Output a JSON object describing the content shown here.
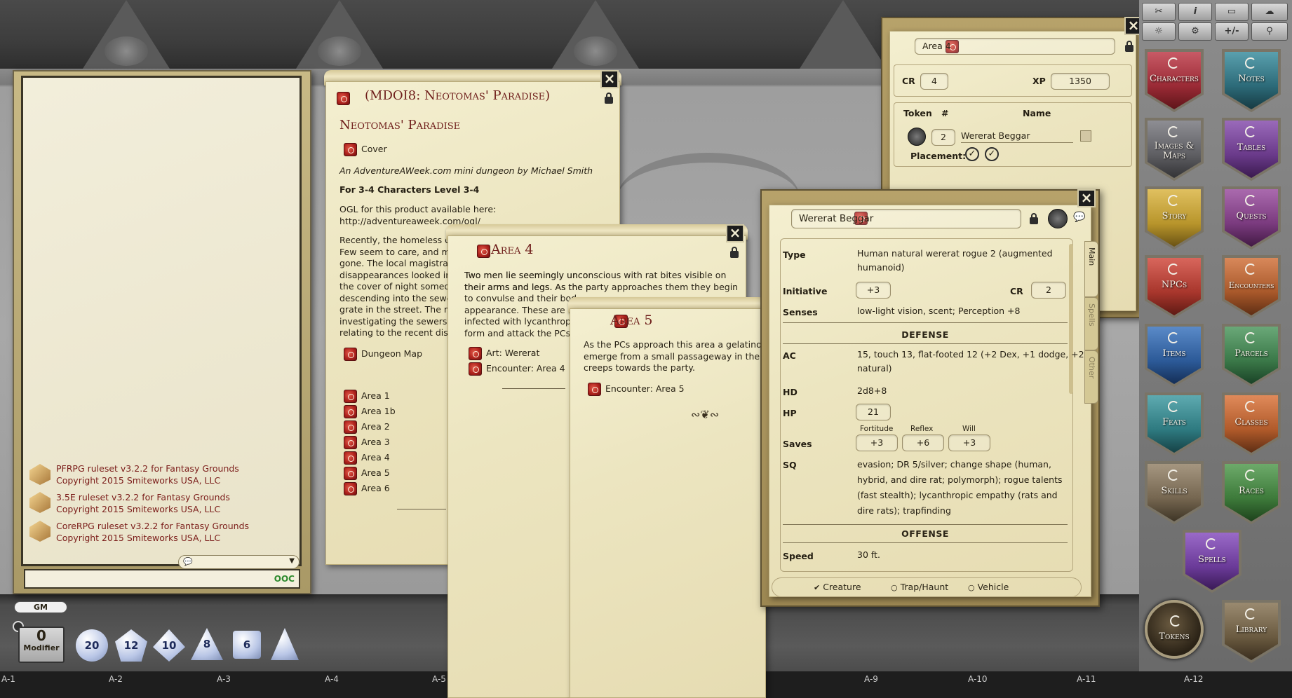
{
  "chat": {
    "messages": [
      {
        "line1": "PFRPG ruleset v3.2.2 for Fantasy Grounds",
        "line2": "Copyright 2015 Smiteworks USA, LLC"
      },
      {
        "line1": "3.5E ruleset v3.2.2 for Fantasy Grounds",
        "line2": "Copyright 2015 Smiteworks USA, LLC"
      },
      {
        "line1": "CoreRPG ruleset v3.2.2 for Fantasy Grounds",
        "line2": "Copyright 2015 Smiteworks USA, LLC"
      }
    ],
    "mode_label": "OOC",
    "gm_label": "GM"
  },
  "modifier": {
    "value": "0",
    "label": "Modifier"
  },
  "dice": [
    "20",
    "12",
    "10",
    "8",
    "6",
    "4"
  ],
  "grid_labels": [
    "A-1",
    "A-2",
    "A-3",
    "A-4",
    "A-5",
    "A-9",
    "A-10",
    "A-11",
    "A-12"
  ],
  "story": {
    "window_title": "(MDOI8: Neotomas' Paradise)",
    "heading": "Neotomas' Paradise",
    "cover_link": "Cover",
    "byline": "An AdventureAWeek.com mini dungeon by Michael Smith",
    "level": "For 3-4 Characters Level 3-4",
    "ogl1": "OGL for this product available here:",
    "ogl2": "http://adventureaweek.com/ogl/",
    "para": [
      "Recently, the homeless of",
      "Few seem to care, and ma",
      "gone. The local magistrat",
      "disappearances looked int",
      "the cover of night someo",
      "descending into the sewe",
      "grate in the street. The m",
      "investigating the sewers",
      "relating to the recent dis"
    ],
    "map_link": "Dungeon Map",
    "areas": [
      "Area 1",
      "Area 1b",
      "Area 2",
      "Area 3",
      "Area 4",
      "Area 5",
      "Area 6"
    ]
  },
  "area4": {
    "title": "Area 4",
    "text": [
      "Two men lie seemingly unconscious with rat bites visible on",
      "their arms and legs. As the party approaches them they begin",
      "to convulse and their bod",
      "appearance. These are tw",
      "infected with lycanthrop",
      "form and attack the PCs."
    ],
    "links": [
      "Art: Wererat",
      "Encounter: Area 4"
    ]
  },
  "area5": {
    "title": "Area 5",
    "text": [
      "As the PCs approach this area a gelatinous",
      "emerge from a small passageway in the no",
      "creeps towards the party."
    ],
    "link": "Encounter: Area 5"
  },
  "encounter": {
    "name": "Area 4",
    "cr_label": "CR",
    "cr": "4",
    "xp_label": "XP",
    "xp": "1350",
    "token_header": "Token",
    "count_header": "#",
    "name_header": "Name",
    "count": "2",
    "creature": "Wererat Beggar",
    "placement_label": "Placement:"
  },
  "npc": {
    "name": "Wererat Beggar",
    "tabs": [
      "Main",
      "Spells",
      "Other"
    ],
    "type_label": "Type",
    "type": [
      "Human natural wererat rogue 2 (augmented",
      "humanoid)"
    ],
    "init_label": "Initiative",
    "init": "+3",
    "cr_label": "CR",
    "cr": "2",
    "senses_label": "Senses",
    "senses": "low-light vision, scent; Perception +8",
    "defense_header": "DEFENSE",
    "ac_label": "AC",
    "ac": [
      "15, touch 13, flat-footed 12 (+2 Dex, +1 dodge, +2",
      "natural)"
    ],
    "hd_label": "HD",
    "hd": "2d8+8",
    "hp_label": "HP",
    "hp": "21",
    "saves_label": "Saves",
    "fort_label": "Fortitude",
    "fort": "+3",
    "ref_label": "Reflex",
    "ref": "+6",
    "will_label": "Will",
    "will": "+3",
    "sq_label": "SQ",
    "sq": [
      "evasion; DR 5/silver; change shape (human,",
      "hybrid, and dire rat; polymorph); rogue talents",
      "(fast stealth); lycanthropic empathy (rats and",
      "dire rats); trapfinding"
    ],
    "offense_header": "OFFENSE",
    "speed_label": "Speed",
    "speed": "30 ft.",
    "types": [
      "Creature",
      "Trap/Haunt",
      "Vehicle"
    ]
  },
  "sidebar": [
    {
      "label": "Characters",
      "color": "#9a2a35"
    },
    {
      "label": "Notes",
      "color": "#2c6a78"
    },
    {
      "label": "Images & Maps",
      "color": "#5e5e62"
    },
    {
      "label": "Tables",
      "color": "#6a3a8a"
    },
    {
      "label": "Story",
      "color": "#b8952b"
    },
    {
      "label": "Quests",
      "color": "#7a3a7e"
    },
    {
      "label": "NPCs",
      "color": "#a8362c"
    },
    {
      "label": "Encounters",
      "color": "#a8582a"
    },
    {
      "label": "Items",
      "color": "#2c5a98"
    },
    {
      "label": "Parcels",
      "color": "#3a7848"
    },
    {
      "label": "Feats",
      "color": "#2e7a80"
    },
    {
      "label": "Classes",
      "color": "#b05a2a"
    },
    {
      "label": "Skills",
      "color": "#756650"
    },
    {
      "label": "Races",
      "color": "#3d7a3a"
    },
    {
      "label": "Spells",
      "color": "#6a3a98"
    }
  ],
  "bottom_buttons": [
    {
      "label": "Tokens"
    },
    {
      "label": "Library"
    }
  ],
  "toolbar": [
    "✂",
    "i",
    "▭",
    "☁",
    "☼",
    "⚙",
    "+/-",
    "⚲"
  ]
}
